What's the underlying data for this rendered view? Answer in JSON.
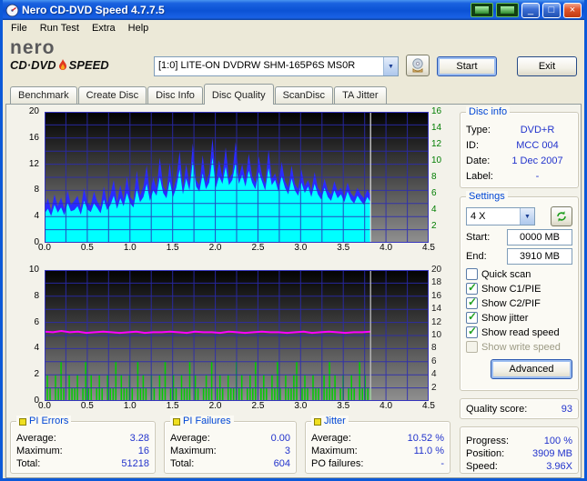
{
  "window": {
    "title": "Nero CD-DVD Speed 4.7.7.5",
    "controls": {
      "minimize": "_",
      "maximize": "□",
      "close": "×"
    }
  },
  "menu": {
    "items": [
      "File",
      "Run Test",
      "Extra",
      "Help"
    ]
  },
  "logo": {
    "brand": "nero",
    "product_left": "CD·DVD",
    "product_right": "SPEED"
  },
  "icons": {
    "dropdown_arrow": "▼"
  },
  "drive": {
    "selected": "[1:0] LITE-ON DVDRW SHM-165P6S MS0R"
  },
  "actions": {
    "start": "Start",
    "exit": "Exit"
  },
  "tabs": {
    "items": [
      {
        "label": "Benchmark",
        "active": false
      },
      {
        "label": "Create Disc",
        "active": false
      },
      {
        "label": "Disc Info",
        "active": false
      },
      {
        "label": "Disc Quality",
        "active": true
      },
      {
        "label": "ScanDisc",
        "active": false
      },
      {
        "label": "TA Jitter",
        "active": false
      }
    ]
  },
  "disc_info": {
    "title": "Disc info",
    "rows": [
      {
        "label": "Type:",
        "value": "DVD+R"
      },
      {
        "label": "ID:",
        "value": "MCC 004"
      },
      {
        "label": "Date:",
        "value": "1 Dec 2007"
      },
      {
        "label": "Label:",
        "value": "-"
      }
    ]
  },
  "settings": {
    "title": "Settings",
    "speed_selected": "4 X",
    "start_label": "Start:",
    "start_value": "0000 MB",
    "end_label": "End:",
    "end_value": "3910 MB",
    "checkboxes": [
      {
        "label": "Quick scan",
        "checked": false,
        "enabled": true
      },
      {
        "label": "Show C1/PIE",
        "checked": true,
        "enabled": true
      },
      {
        "label": "Show C2/PIF",
        "checked": true,
        "enabled": true
      },
      {
        "label": "Show jitter",
        "checked": true,
        "enabled": true
      },
      {
        "label": "Show read speed",
        "checked": true,
        "enabled": true
      },
      {
        "label": "Show write speed",
        "checked": false,
        "enabled": false
      }
    ],
    "advanced": "Advanced"
  },
  "quality": {
    "label": "Quality score:",
    "value": "93"
  },
  "progress": {
    "rows": [
      {
        "label": "Progress:",
        "value": "100 %"
      },
      {
        "label": "Position:",
        "value": "3909 MB"
      },
      {
        "label": "Speed:",
        "value": "3.96X"
      }
    ]
  },
  "stats": [
    {
      "title": "PI Errors",
      "rows": [
        {
          "label": "Average:",
          "value": "3.28"
        },
        {
          "label": "Maximum:",
          "value": "16"
        },
        {
          "label": "Total:",
          "value": "51218"
        }
      ]
    },
    {
      "title": "PI Failures",
      "rows": [
        {
          "label": "Average:",
          "value": "0.00"
        },
        {
          "label": "Maximum:",
          "value": "3"
        },
        {
          "label": "Total:",
          "value": "604"
        }
      ]
    },
    {
      "title": "Jitter",
      "rows": [
        {
          "label": "Average:",
          "value": "10.52 %"
        },
        {
          "label": "Maximum:",
          "value": "11.0 %"
        },
        {
          "label": "PO failures:",
          "value": "-"
        }
      ]
    }
  ],
  "colors": {
    "window_bg": "#ECE9D8",
    "titlebar_blue": "#0C59D8",
    "group_title": "#0046D5",
    "value_text": "#2233cc",
    "legend_chip": "#efdf20",
    "check_green": "#21A121",
    "pie": "#00ffff",
    "pie_max": "#2b2bff",
    "pif": "#00cc00",
    "jitter": "#ff00ff",
    "speed_axis": "#007d00"
  },
  "chart_data": [
    {
      "type": "area",
      "name": "pi-errors-vs-position",
      "x_range": [
        0,
        4.5
      ],
      "x_ticks": [
        "0.0",
        "0.5",
        "1.0",
        "1.5",
        "2.0",
        "2.5",
        "3.0",
        "3.5",
        "4.0",
        "4.5"
      ],
      "y_left": {
        "max": 20,
        "ticks": [
          0,
          4,
          8,
          12,
          16,
          20
        ],
        "divisions": 10
      },
      "y_right": {
        "max": 16,
        "ticks": [
          2,
          4,
          6,
          8,
          10,
          12,
          14,
          16
        ],
        "color": "#007d00"
      },
      "grid_color": "#2a2ab4",
      "scan_end_x": 3.82,
      "end_marker_color": "#e0e0e0",
      "summary": {
        "average": 3.28,
        "maximum": 16,
        "total": 51218
      },
      "series": [
        {
          "name": "pi-errors-max",
          "color": "#2b2bff",
          "axis": "left",
          "style": "area",
          "values": [
            5.5,
            6.8,
            5.0,
            7.4,
            5.6,
            6.9,
            5.2,
            8.0,
            5.8,
            6.4,
            7.2,
            5.3,
            8.4,
            6.1,
            5.7,
            7.8,
            6.3,
            5.5,
            8.6,
            6.0,
            7.4,
            9.6,
            6.2,
            8.8,
            6.6,
            10.2,
            7.0,
            6.4,
            11.0,
            7.2,
            8.6,
            11.8,
            7.4,
            10.0,
            8.2,
            13.0,
            8.6,
            7.8,
            12.2,
            8.0,
            9.8,
            14.0,
            8.4,
            12.0,
            9.0,
            15.2,
            9.6,
            8.8,
            13.4,
            9.2,
            10.6,
            16.0,
            9.4,
            12.6,
            10.0,
            14.6,
            9.8,
            10.6,
            15.4,
            10.0,
            12.0,
            9.6,
            13.6,
            10.2,
            9.2,
            13.2,
            10.4,
            9.0,
            14.2,
            9.8,
            10.6,
            8.8,
            12.4,
            9.4,
            8.4,
            11.8,
            9.0,
            8.2,
            11.2,
            8.6,
            9.6,
            8.0,
            10.8,
            8.4,
            7.6,
            9.8,
            8.0,
            7.4,
            9.4,
            7.8,
            8.4,
            7.2,
            9.2,
            7.6,
            7.0,
            8.4,
            7.4,
            6.8,
            8.2,
            7.2
          ]
        },
        {
          "name": "pi-errors",
          "color": "#00ffff",
          "axis": "left",
          "style": "area",
          "values": [
            4.5,
            5.2,
            4.1,
            5.8,
            4.6,
            5.4,
            4.2,
            6.1,
            4.8,
            5.0,
            5.6,
            4.3,
            6.4,
            5.1,
            4.7,
            6.0,
            5.3,
            4.5,
            6.6,
            5.0,
            5.8,
            7.2,
            5.2,
            6.8,
            5.6,
            7.6,
            6.0,
            5.4,
            8.2,
            6.2,
            7.0,
            9.0,
            6.4,
            8.0,
            7.2,
            10.0,
            7.6,
            6.8,
            9.4,
            7.0,
            8.4,
            11.2,
            7.4,
            9.8,
            8.0,
            12.4,
            8.6,
            7.8,
            10.6,
            8.2,
            9.2,
            13.0,
            8.4,
            10.2,
            9.0,
            11.6,
            8.8,
            9.6,
            12.2,
            9.0,
            10.4,
            8.6,
            11.0,
            9.2,
            8.2,
            10.8,
            9.4,
            8.0,
            11.4,
            8.8,
            9.6,
            7.8,
            10.2,
            8.4,
            7.4,
            9.8,
            8.0,
            7.2,
            9.2,
            7.6,
            8.6,
            7.0,
            9.0,
            7.4,
            6.6,
            8.4,
            7.0,
            6.4,
            8.0,
            6.8,
            7.4,
            6.2,
            7.8,
            6.6,
            6.0,
            7.2,
            6.4,
            5.8,
            7.0,
            6.2
          ]
        }
      ]
    },
    {
      "type": "bar",
      "name": "pi-failures-and-jitter-vs-position",
      "x_range": [
        0,
        4.5
      ],
      "x_ticks": [
        "0.0",
        "0.5",
        "1.0",
        "1.5",
        "2.0",
        "2.5",
        "3.0",
        "3.5",
        "4.0",
        "4.5"
      ],
      "y_left": {
        "max": 10,
        "ticks": [
          0,
          2,
          4,
          6,
          8,
          10
        ],
        "divisions": 10
      },
      "y_right": {
        "max": 20,
        "ticks": [
          2,
          4,
          6,
          8,
          10,
          12,
          14,
          16,
          18,
          20
        ],
        "color": "#1a1a1a"
      },
      "grid_color": "#2a2ab4",
      "scan_end_x": 3.82,
      "end_marker_color": "#c8c8c8",
      "summary": {
        "pif_average": 0.0,
        "pif_maximum": 3,
        "pif_total": 604,
        "jitter_average_pct": 10.52,
        "jitter_maximum_pct": 11.0
      },
      "series": [
        {
          "name": "pi-failures",
          "color": "#00cc00",
          "axis": "left",
          "style": "bars",
          "values": [
            1,
            2,
            1,
            0,
            2,
            1,
            3,
            1,
            0,
            2,
            1,
            1,
            2,
            0,
            1,
            3,
            1,
            2,
            0,
            1,
            2,
            1,
            0,
            2,
            1,
            1,
            3,
            0,
            2,
            1,
            1,
            2,
            1,
            0,
            3,
            1,
            2,
            1,
            0,
            2,
            1,
            0,
            2,
            1,
            3,
            0,
            1,
            2,
            1,
            0,
            2,
            1,
            1,
            3,
            0,
            2,
            1,
            0,
            1,
            2,
            1,
            3,
            0,
            1,
            2,
            1,
            0,
            2,
            1,
            1,
            3,
            1,
            2,
            0,
            1,
            2,
            1,
            3,
            0,
            1,
            2,
            1,
            0,
            2,
            1,
            3,
            1,
            0,
            2,
            1,
            1,
            2,
            3,
            0,
            1,
            2,
            1,
            0,
            2,
            1,
            1,
            0,
            2,
            1,
            3,
            1,
            2,
            0,
            1,
            2,
            0,
            1,
            2,
            1,
            0,
            3,
            1,
            2,
            1,
            1
          ]
        }
      ],
      "jitter": {
        "name": "jitter-percent",
        "color": "#ff00ff",
        "axis": "right",
        "values": [
          10.6,
          10.5,
          10.7,
          10.5,
          10.6,
          10.4,
          10.5,
          10.6,
          10.5,
          10.4,
          10.5,
          10.6,
          10.4,
          10.5,
          10.5,
          10.6,
          10.5,
          10.4,
          10.6,
          10.5,
          10.5,
          10.4,
          10.6,
          10.5,
          10.4,
          10.5,
          10.6,
          10.5,
          10.5,
          10.4,
          10.5,
          10.6,
          10.4,
          10.5,
          10.6,
          10.5,
          10.4,
          10.5,
          10.5,
          10.6
        ]
      }
    }
  ]
}
